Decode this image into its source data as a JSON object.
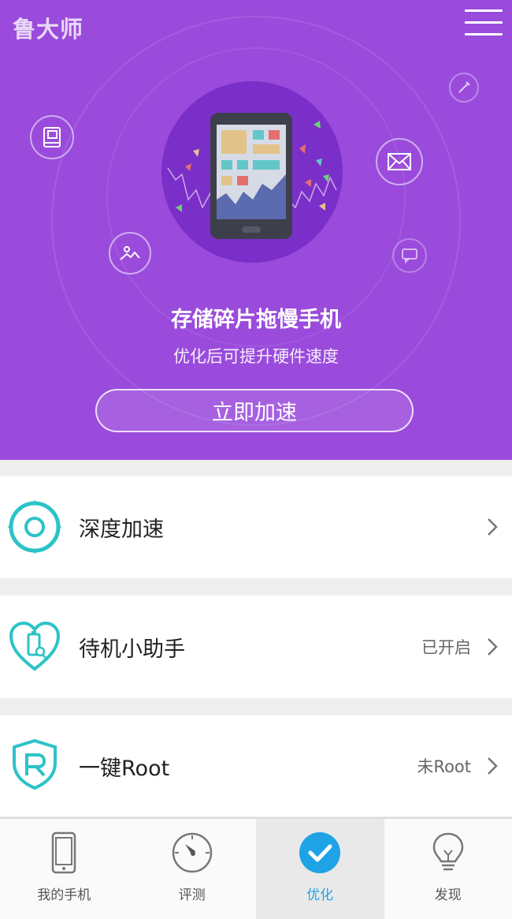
{
  "header": {
    "app_logo": "鲁大师"
  },
  "hero": {
    "title": "存储碎片拖慢手机",
    "subtitle": "优化后可提升硬件速度",
    "button_label": "立即加速"
  },
  "list": [
    {
      "title": "深度加速",
      "status": ""
    },
    {
      "title": "待机小助手",
      "status": "已开启"
    },
    {
      "title": "一键Root",
      "status": "未Root"
    }
  ],
  "tabs": [
    {
      "label": "我的手机",
      "icon": "phone-icon",
      "active": false
    },
    {
      "label": "评测",
      "icon": "gauge-icon",
      "active": false
    },
    {
      "label": "优化",
      "icon": "check-circle-icon",
      "active": true
    },
    {
      "label": "发现",
      "icon": "lightbulb-icon",
      "active": false
    }
  ],
  "colors": {
    "hero_bg": "#9a4bdc",
    "accent": "#1fa3e6",
    "teal": "#2cc3c8"
  }
}
